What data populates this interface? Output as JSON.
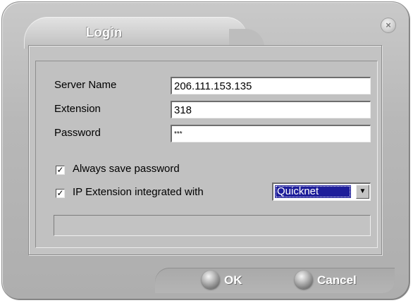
{
  "dialog": {
    "title": "Login",
    "close_label": "×"
  },
  "form": {
    "server_name_label": "Server Name",
    "server_name_value": "206.111.153.135",
    "extension_label": "Extension",
    "extension_value": "318",
    "password_label": "Password",
    "password_value": "***",
    "save_password_label": "Always save password",
    "save_password_checked": true,
    "ip_extension_label": "IP Extension integrated with",
    "ip_extension_checked": true,
    "integration_selected": "Quicknet",
    "check_glyph": "✓",
    "dropdown_glyph": "▼"
  },
  "status": {
    "text": ""
  },
  "buttons": {
    "ok_label": "OK",
    "cancel_label": "Cancel"
  }
}
